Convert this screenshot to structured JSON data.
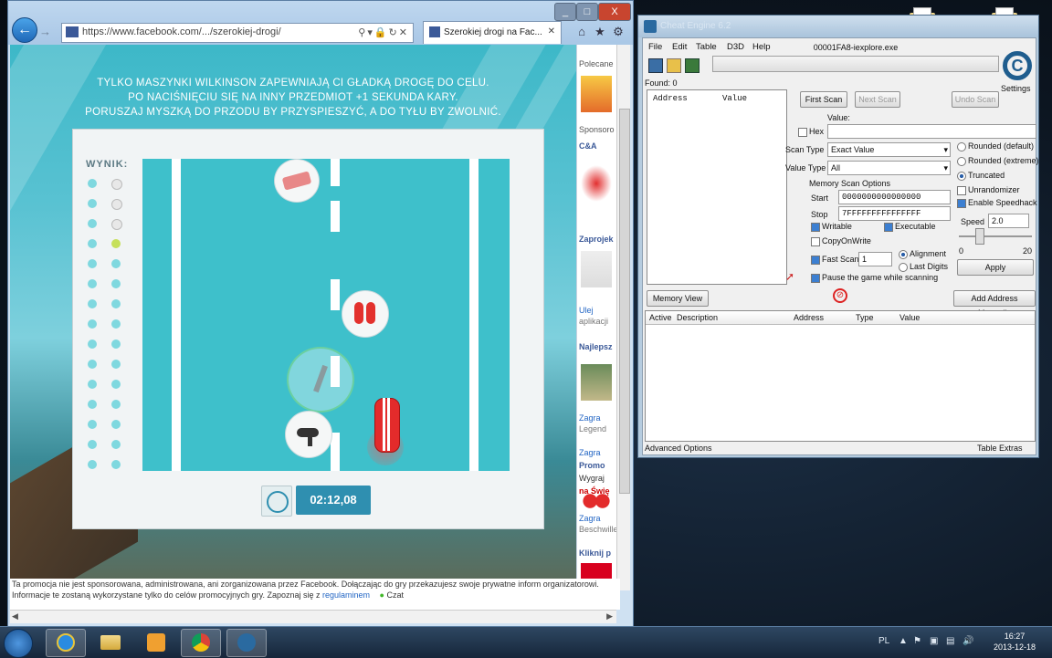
{
  "desktop": {
    "icon_labels": [
      "",
      ""
    ]
  },
  "browser": {
    "url": "https://www.facebook.com/.../szerokiej-drogi/",
    "tab_label": "Szerokiej drogi na Fac...",
    "window_controls": {
      "minimize": "_",
      "maximize": "□",
      "close": "X"
    },
    "toolbar_icons": [
      "home-icon",
      "star-icon",
      "gear-icon"
    ]
  },
  "game": {
    "instructions": [
      "TYLKO MASZYNKI WILKINSON ZAPEWNIAJĄ CI GŁADKĄ DROGĘ DO CELU.",
      "PO NACIŚNIĘCIU SIĘ NA INNY PRZEDMIOT +1 SEKUNDA KARY.",
      "PORUSZAJ MYSZKĄ DO PRZODU BY PRZYSPIESZYĆ, A DO TYŁU BY ZWOLNIĆ."
    ],
    "score_label": "WYNIK:",
    "timer": "02:12,08"
  },
  "sidebar": {
    "labels": [
      "Polecane",
      "Sponsoro",
      "C&A",
      "Zaprojek",
      "Ulej",
      "aplikacji",
      "Najlepsz",
      "Zagra",
      "Legend",
      "Zagra",
      "Promo",
      "Wygraj",
      "na Świę",
      "Zagra",
      "Beschwille",
      "Kliknij p"
    ]
  },
  "footer": {
    "text": "Ta promocja nie jest sponsorowana, administrowana, ani zorganizowana przez Facebook. Dołączając do gry przekazujesz swoje prywatne inform organizatorowi. Informacje te zostaną wykorzystane tylko do celów promocyjnych gry. Zapoznaj się z",
    "link": "regulaminem",
    "chat": "Czat"
  },
  "cheat_engine": {
    "title": "Cheat Engine 6.2",
    "menu": [
      "File",
      "Edit",
      "Table",
      "D3D",
      "Help"
    ],
    "process": "00001FA8-iexplore.exe",
    "found": "Found: 0",
    "results_cols": [
      "Address",
      "Value"
    ],
    "first_scan": "First Scan",
    "next_scan": "Next Scan",
    "undo_scan": "Undo Scan",
    "settings": "Settings",
    "value_label": "Value:",
    "hex_label": "Hex",
    "scan_type_label": "Scan Type",
    "scan_type_value": "Exact Value",
    "value_type_label": "Value Type",
    "value_type_value": "All",
    "memory_scan_options": "Memory Scan Options",
    "start_label": "Start",
    "start_value": "0000000000000000",
    "stop_label": "Stop",
    "stop_value": "7FFFFFFFFFFFFFFF",
    "writable": "Writable",
    "executable": "Executable",
    "copy_on_write": "CopyOnWrite",
    "fast_scan": "Fast Scan",
    "fast_scan_value": "1",
    "alignment": "Alignment",
    "last_digits": "Last Digits",
    "pause_game": "Pause the game while scanning",
    "rounded_default": "Rounded (default)",
    "rounded_extreme": "Rounded (extreme)",
    "truncated": "Truncated",
    "unrandomizer": "Unrandomizer",
    "enable_speedhack": "Enable Speedhack",
    "speed_label": "Speed",
    "speed_value": "2.0",
    "slider_min": "0",
    "slider_max": "20",
    "apply": "Apply",
    "memory_view": "Memory View",
    "add_address": "Add Address Manually",
    "addr_cols": [
      "Active",
      "Description",
      "Address",
      "Type",
      "Value"
    ],
    "advanced_options": "Advanced Options",
    "table_extras": "Table Extras"
  },
  "taskbar": {
    "time": "16:27",
    "date": "2013-12-18",
    "tray_lang": "PL"
  }
}
